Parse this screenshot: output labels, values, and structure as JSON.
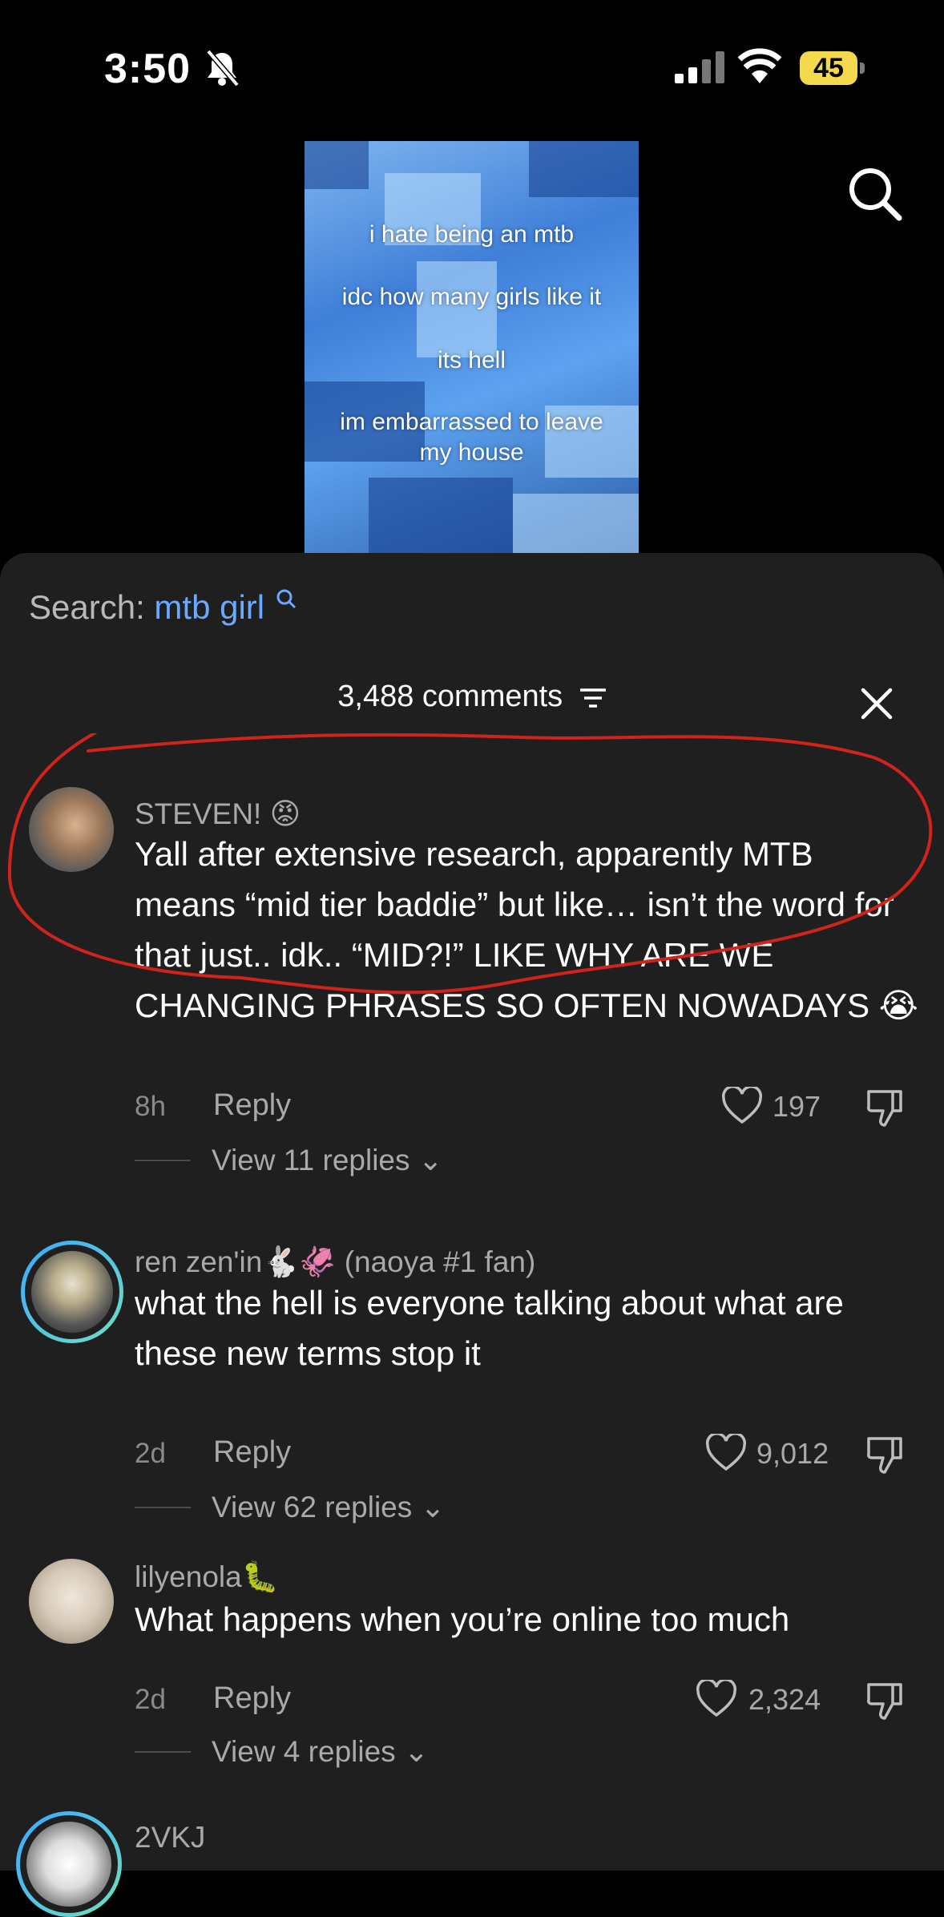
{
  "status_bar": {
    "time": "3:50",
    "battery": "45"
  },
  "video": {
    "overlay_lines": [
      "i hate being an mtb",
      "idc how many girls like it",
      "its hell",
      "im embarrassed to leave",
      "my house"
    ]
  },
  "search": {
    "label": "Search:",
    "term": "mtb girl"
  },
  "comments_header": {
    "count": "3,488 comments"
  },
  "comments": [
    {
      "username": "STEVEN! 😡",
      "text": "Yall after extensive research, apparently MTB means “mid tier baddie” but like… isn’t the word for that just.. idk.. “MID?!” LIKE WHY ARE WE CHANGING PHRASES SO OFTEN NOWADAYS 😭",
      "time": "8h",
      "reply": "Reply",
      "likes": "197",
      "view_replies": "View 11 replies"
    },
    {
      "username": "ren zen'in🐇🦑 (naoya #1 fan)",
      "text": "what the hell is everyone talking about what are these new terms stop it",
      "time": "2d",
      "reply": "Reply",
      "likes": "9,012",
      "view_replies": "View 62 replies"
    },
    {
      "username": "lilyenola🐛",
      "text": "What happens when you’re online too much",
      "time": "2d",
      "reply": "Reply",
      "likes": "2,324",
      "view_replies": "View 4 replies"
    },
    {
      "username": "2VKJ"
    }
  ],
  "colors": {
    "accent_link": "#6aa9ff",
    "sheet_bg": "#1f1f1f",
    "annotation": "#d0231b",
    "battery": "#f2d94e"
  }
}
